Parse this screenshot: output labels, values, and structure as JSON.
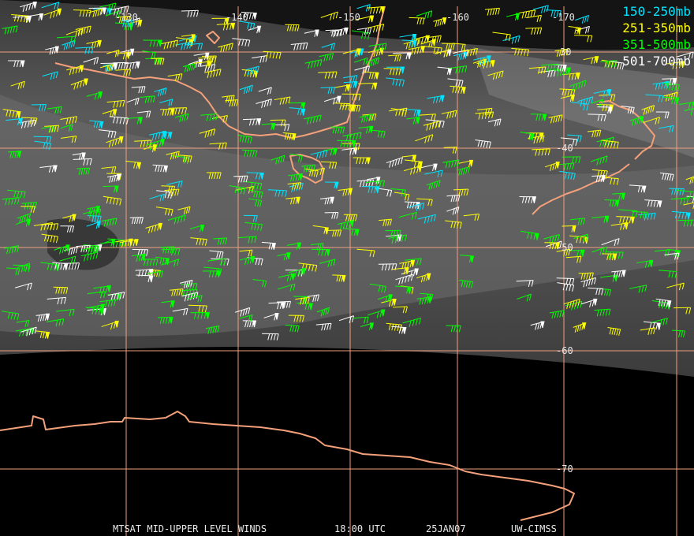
{
  "map": {
    "longitude_labels": [
      "-130",
      "-140",
      "-150",
      "-160",
      "-170"
    ],
    "latitude_labels": [
      "30",
      "-40",
      "-50",
      "-60",
      "-70"
    ]
  },
  "legend": [
    {
      "label": "150-250mb",
      "color": "#00e5ff"
    },
    {
      "label": "251-350mb",
      "color": "#ffff00"
    },
    {
      "label": "351-500mb",
      "color": "#00ff00"
    },
    {
      "label": "501-700mb",
      "color": "#ffffff"
    }
  ],
  "footer": {
    "product": "MTSAT MID-UPPER LEVEL WINDS",
    "time": "18:00 UTC",
    "date": "25JAN07",
    "source": "UW-CIMSS"
  },
  "colors": {
    "grid": "#f0a080",
    "coast": "#f4a07a",
    "space": "#000000"
  }
}
